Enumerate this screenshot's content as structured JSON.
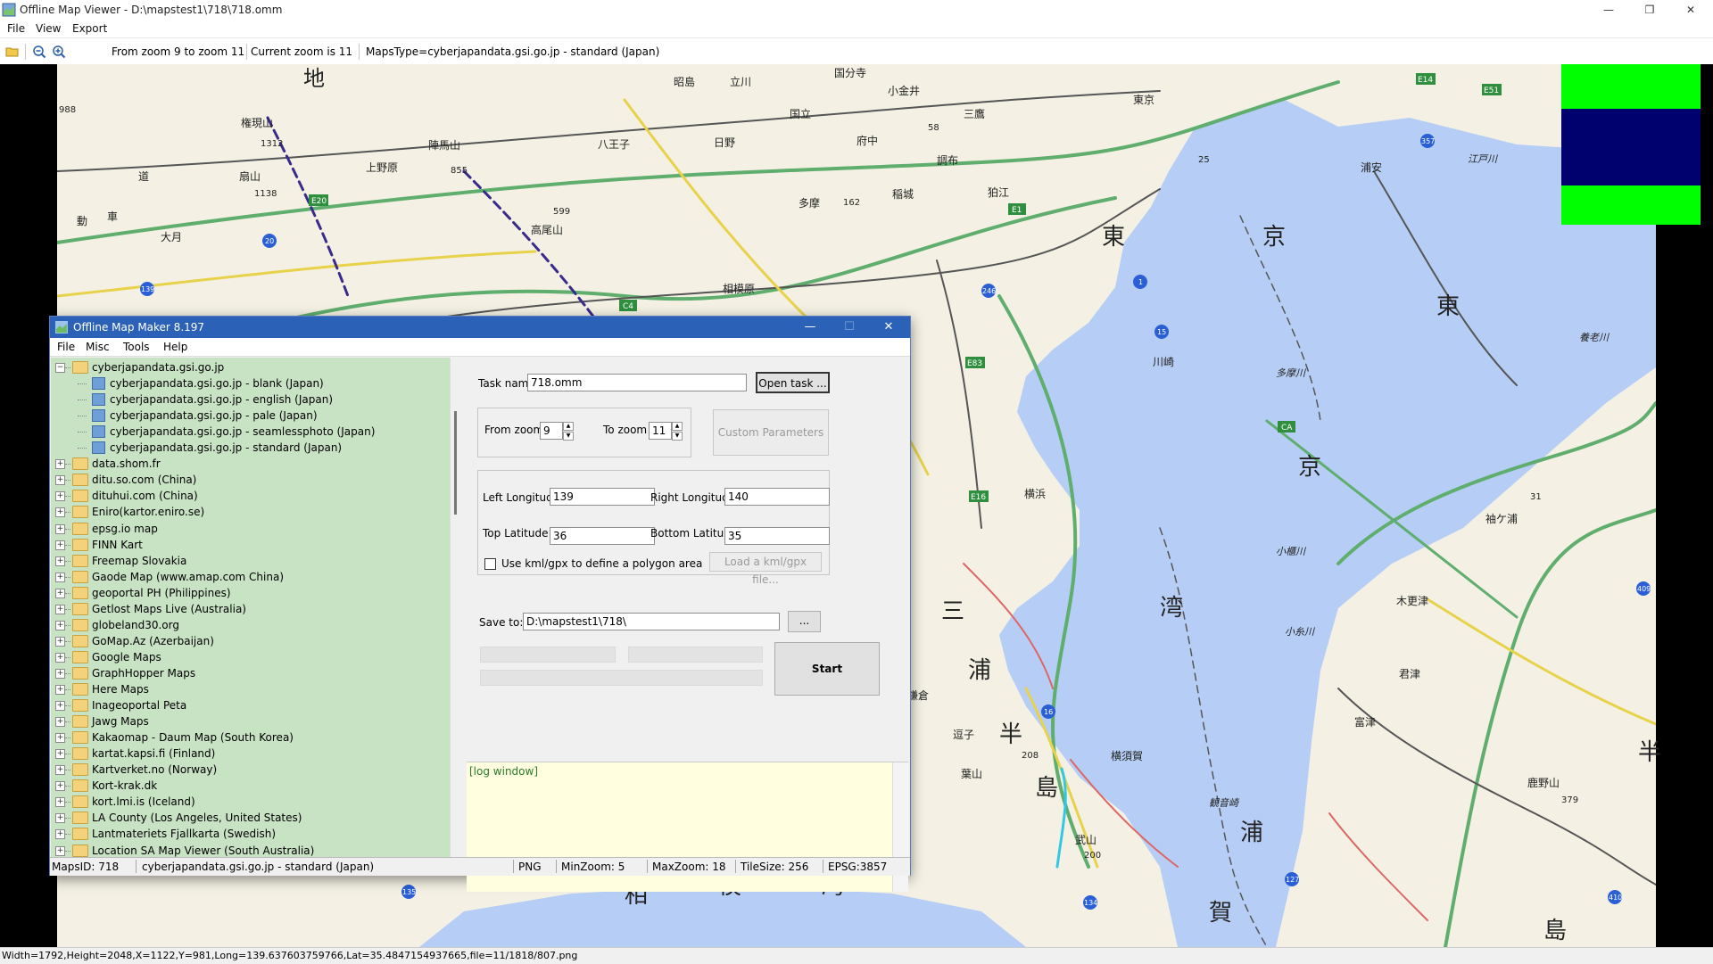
{
  "window": {
    "title": "Offline Map Viewer - D:\\mapstest1\\718\\718.omm",
    "controls": [
      "—",
      "❐",
      "✕"
    ]
  },
  "menu": [
    "File",
    "View",
    "Export"
  ],
  "toolbar": {
    "zoom_range": "From zoom 9 to zoom 11",
    "current_zoom": "Current zoom is 11",
    "maps_type": "MapsType=cyberjapandata.gsi.go.jp - standard (Japan)"
  },
  "map": {
    "labels": [
      "昭島",
      "立川",
      "国分寺",
      "小金井",
      "東京",
      "国立",
      "三鷹",
      "府中",
      "八王子",
      "日野",
      "調布",
      "稲城",
      "狛江",
      "多摩",
      "相模原",
      "権現山",
      "陣馬山",
      "扇山",
      "上野原",
      "大月",
      "高尾山",
      "東",
      "京",
      "東",
      "京",
      "川崎",
      "横浜",
      "多摩川",
      "浦安",
      "江戸川",
      "養老川",
      "袖ケ浦",
      "木更津",
      "小櫃川",
      "小糸川",
      "君津",
      "富津",
      "鹿野山",
      "観音崎",
      "横須賀",
      "武山",
      "三",
      "浦",
      "半",
      "島",
      "湾",
      "浦",
      "賀",
      "相",
      "模",
      "湾",
      "鎌倉",
      "逗子",
      "葉山",
      "島",
      "半",
      "動",
      "車",
      "道",
      "地",
      "988",
      "1312",
      "1138",
      "855",
      "599",
      "162",
      "58",
      "25",
      "31",
      "208",
      "200",
      "379",
      "E20",
      "E1",
      "E14",
      "E51",
      "C4",
      "CA",
      "E83",
      "E16",
      "139",
      "20",
      "246",
      "15",
      "1",
      "16",
      "357",
      "409",
      "410",
      "127",
      "134",
      "135"
    ],
    "top_right_colors": [
      "#00ff00",
      "#00006e",
      "#00ff00"
    ]
  },
  "statusbar": "Width=1792,Height=2048,X=1122,Y=981,Long=139.637603759766,Lat=35.4847154937665,file=11/1818/807.png",
  "dialog": {
    "title": "Offline Map Maker 8.197",
    "menu": [
      "File",
      "Misc",
      "Tools",
      "Help"
    ],
    "tree": [
      {
        "label": "cyberjapandata.gsi.go.jp",
        "level": 0,
        "expanded": true
      },
      {
        "label": "cyberjapandata.gsi.go.jp - blank (Japan)",
        "level": 1
      },
      {
        "label": "cyberjapandata.gsi.go.jp - english (Japan)",
        "level": 1
      },
      {
        "label": "cyberjapandata.gsi.go.jp - pale (Japan)",
        "level": 1
      },
      {
        "label": "cyberjapandata.gsi.go.jp - seamlessphoto (Japan)",
        "level": 1
      },
      {
        "label": "cyberjapandata.gsi.go.jp - standard (Japan)",
        "level": 1
      },
      {
        "label": "data.shom.fr",
        "level": 0
      },
      {
        "label": "ditu.so.com (China)",
        "level": 0
      },
      {
        "label": "dituhui.com (China)",
        "level": 0
      },
      {
        "label": "Eniro(kartor.eniro.se)",
        "level": 0
      },
      {
        "label": "epsg.io map",
        "level": 0
      },
      {
        "label": "FINN Kart",
        "level": 0
      },
      {
        "label": "Freemap Slovakia",
        "level": 0
      },
      {
        "label": "Gaode Map (www.amap.com China)",
        "level": 0
      },
      {
        "label": "geoportal PH (Philippines)",
        "level": 0
      },
      {
        "label": "Getlost Maps Live (Australia)",
        "level": 0
      },
      {
        "label": "globeland30.org",
        "level": 0
      },
      {
        "label": "GoMap.Az (Azerbaijan)",
        "level": 0
      },
      {
        "label": "Google Maps",
        "level": 0
      },
      {
        "label": "GraphHopper Maps",
        "level": 0
      },
      {
        "label": "Here Maps",
        "level": 0
      },
      {
        "label": "Inageoportal Peta",
        "level": 0
      },
      {
        "label": "Jawg Maps",
        "level": 0
      },
      {
        "label": "Kakaomap - Daum Map (South Korea)",
        "level": 0
      },
      {
        "label": "kartat.kapsi.fi (Finland)",
        "level": 0
      },
      {
        "label": "Kartverket.no (Norway)",
        "level": 0
      },
      {
        "label": "Kort-krak.dk",
        "level": 0
      },
      {
        "label": "kort.lmi.is (Iceland)",
        "level": 0
      },
      {
        "label": "LA County (Los Angeles, United States)",
        "level": 0
      },
      {
        "label": "Lantmateriets Fjallkarta (Swedish)",
        "level": 0
      },
      {
        "label": "Location SA Map Viewer (South Australia)",
        "level": 0
      }
    ],
    "form": {
      "task_name_label": "Task name",
      "task_name_value": "718.omm",
      "open_task": "Open task ...",
      "from_zoom_label": "From zoom",
      "from_zoom_value": "9",
      "to_zoom_label": "To zoom",
      "to_zoom_value": "11",
      "custom_params": "Custom Parameters",
      "left_lon_label": "Left Longitude",
      "left_lon_value": "139",
      "right_lon_label": "Right Longitude",
      "right_lon_value": "140",
      "top_lat_label": "Top Latitude",
      "top_lat_value": "36",
      "bottom_lat_label": "Bottom Latitude",
      "bottom_lat_value": "35",
      "kml_label": "Use kml/gpx to define a polygon area",
      "load_kml": "Load a kml/gpx file...",
      "save_label": "Save to:",
      "save_value": "D:\\mapstest1\\718\\",
      "browse": "...",
      "start": "Start",
      "log": "[log window]"
    },
    "status": {
      "maps_id": "MapsID: 718",
      "maps_name": "cyberjapandata.gsi.go.jp - standard (Japan)",
      "format": "PNG",
      "min_zoom": "MinZoom: 5",
      "max_zoom": "MaxZoom: 18",
      "tile_size": "TileSize: 256",
      "epsg": "EPSG:3857"
    },
    "controls": [
      "—",
      "☐",
      "✕"
    ]
  }
}
